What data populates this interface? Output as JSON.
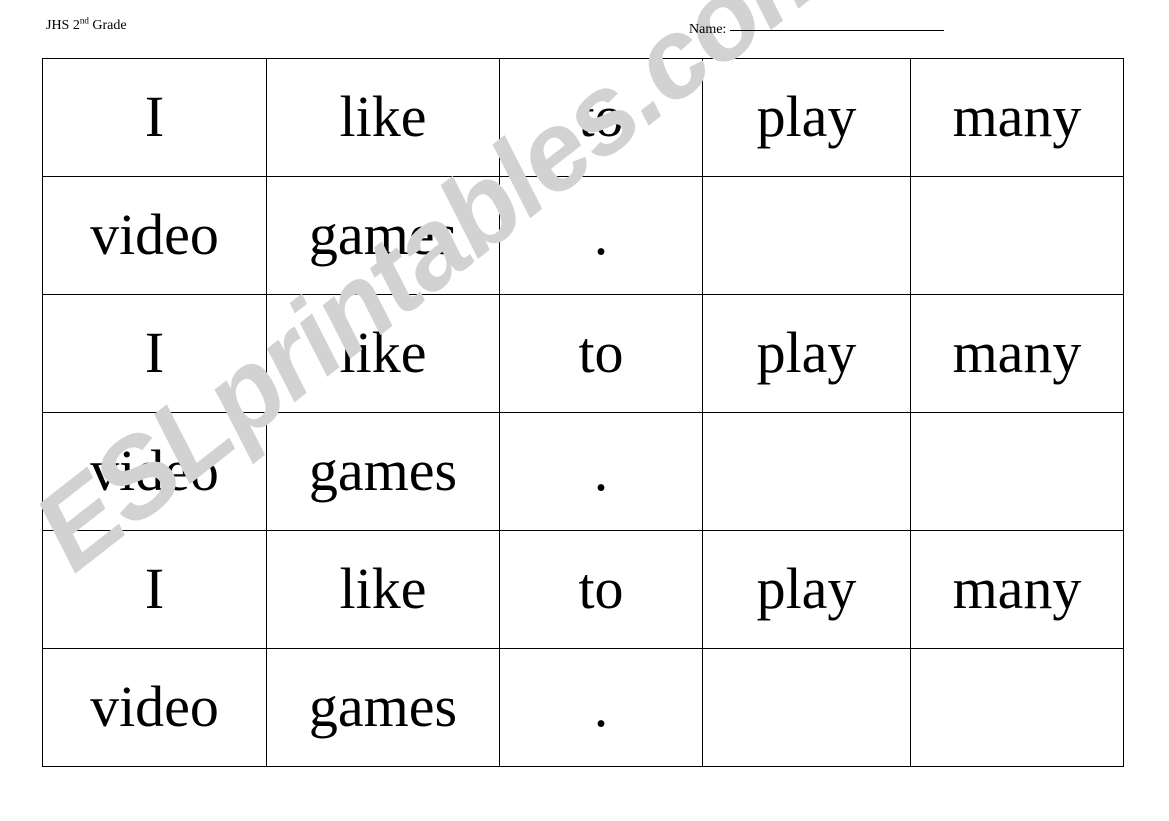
{
  "page": {
    "background_color": "#ffffff",
    "text_color": "#000000"
  },
  "header": {
    "grade_prefix": "JHS 2",
    "grade_ordinal_suffix": "nd",
    "grade_suffix": " Grade",
    "name_label": "Name:",
    "name_value": ""
  },
  "watermark": {
    "text": "ESLprintables.com",
    "color": "#d2d2d2"
  },
  "table": {
    "border_color": "#000000",
    "columns": 5,
    "rows": 6,
    "cells": [
      [
        "I",
        "like",
        "to",
        "play",
        "many"
      ],
      [
        "video",
        "games",
        ".",
        "",
        ""
      ],
      [
        "I",
        "like",
        "to",
        "play",
        "many"
      ],
      [
        "video",
        "games",
        ".",
        "",
        ""
      ],
      [
        "I",
        "like",
        "to",
        "play",
        "many"
      ],
      [
        "video",
        "games",
        ".",
        "",
        ""
      ]
    ]
  }
}
